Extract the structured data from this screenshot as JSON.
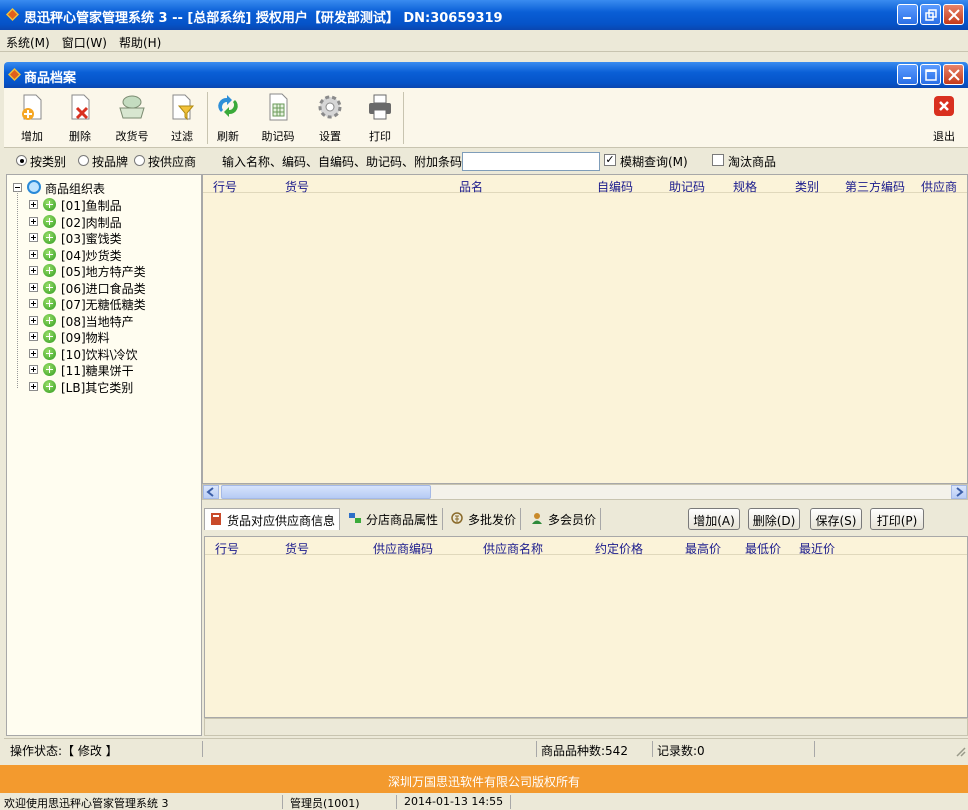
{
  "window": {
    "title": "思迅秤心管家管理系统 3 -- [总部系统] 授权用户【研发部测试】 DN:30659319"
  },
  "menu": [
    "系统(M)",
    "窗口(W)",
    "帮助(H)"
  ],
  "inner_window": {
    "title": "商品档案"
  },
  "toolbar": {
    "items": [
      {
        "label": "增加",
        "icon": "add-doc-icon"
      },
      {
        "label": "删除",
        "icon": "delete-doc-icon"
      },
      {
        "label": "改货号",
        "icon": "scale-icon"
      },
      {
        "label": "过滤",
        "icon": "filter-icon"
      },
      {
        "label": "刷新",
        "icon": "refresh-icon"
      },
      {
        "label": "助记码",
        "icon": "mnemonic-icon"
      },
      {
        "label": "设置",
        "icon": "gear-icon"
      },
      {
        "label": "打印",
        "icon": "printer-icon"
      }
    ],
    "exit_label": "退出"
  },
  "filter": {
    "radios": [
      {
        "label": "按类别",
        "selected": true
      },
      {
        "label": "按品牌",
        "selected": false
      },
      {
        "label": "按供应商",
        "selected": false
      }
    ],
    "search_label": "输入名称、编码、自编码、助记码、附加条码:",
    "search_value": "",
    "fuzzy_label": "模糊查询(M)",
    "fuzzy_checked": true,
    "obsolete_label": "淘汰商品",
    "obsolete_checked": false
  },
  "tree": {
    "root": "商品组织表",
    "items": [
      "[01]鱼制品",
      "[02]肉制品",
      "[03]蜜饯类",
      "[04]炒货类",
      "[05]地方特产类",
      "[06]进口食品类",
      "[07]无糖低糖类",
      "[08]当地特产",
      "[09]物料",
      "[10]饮料\\冷饮",
      "[11]糖果饼干",
      "[LB]其它类别"
    ]
  },
  "main_grid": {
    "columns": [
      "行号",
      "货号",
      "品名",
      "自编码",
      "助记码",
      "规格",
      "类别",
      "第三方编码",
      "供应商"
    ]
  },
  "tabs": [
    "货品对应供应商信息",
    "分店商品属性",
    "多批发价",
    "多会员价"
  ],
  "detail_buttons": [
    "增加(A)",
    "删除(D)",
    "保存(S)",
    "打印(P)"
  ],
  "detail_grid": {
    "columns": [
      "行号",
      "货号",
      "供应商编码",
      "供应商名称",
      "约定价格",
      "最高价",
      "最低价",
      "最近价"
    ]
  },
  "status": {
    "operation": "操作状态:【 修改 】",
    "product_count_label": "商品品种数:",
    "product_count": "542",
    "record_count_label": "记录数:",
    "record_count": "0"
  },
  "copyright": "深圳万国思迅软件有限公司版权所有",
  "bottom": {
    "welcome": "欢迎使用思迅秤心管家管理系统 3",
    "user": "管理员(1001)",
    "datetime": "2014-01-13 14:55"
  },
  "colors": {
    "title_blue": "#0a5fd6",
    "toolbar_bg": "#fbf7ea",
    "grid_bg": "#fbf3d9",
    "header_text": "#1a1a8c",
    "copyright_orange": "#f39a2e",
    "exit_red": "#d9301f"
  }
}
